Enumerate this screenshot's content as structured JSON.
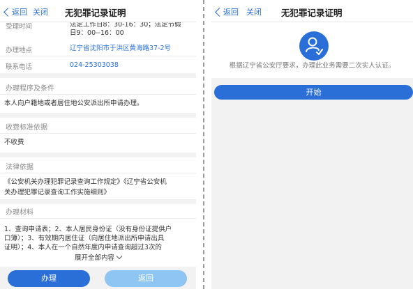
{
  "left": {
    "nav": {
      "back_label": "返回",
      "close_label": "关闭",
      "title": "无犯罪记录证明"
    },
    "info": {
      "hours_label": "受理时间",
      "hours_line1": "法定工作日8：30-16：30；法定节假",
      "hours_line2": "日9：00--16：00",
      "address_label": "办理地点",
      "address_value": "辽宁省沈阳市于洪区黄海路37-2号",
      "phone_label": "联系电话",
      "phone_value": "024-25303038"
    },
    "procedure": {
      "heading": "办理程序及条件",
      "text": "本人向户籍地或者居住地公安派出所申请办理。"
    },
    "fee": {
      "heading": "收费标准依据",
      "text": "不收费"
    },
    "law": {
      "heading": "法律依据",
      "line1": "《公安机关办理犯罪记录查询工作规定》《辽宁省公安机",
      "line2": "关办理犯罪记录查询工作实施细则》"
    },
    "materials": {
      "heading": "办理材料",
      "line1": "1、查询申请表；2、本人居民身份证（没有身份证提供户",
      "line2": "口簿）；3、有效期内居住证（向居住地派出所申请出具",
      "line3": "证明）；4、本人在一个自然年度内申请查询超过3次的",
      "expand_label": "展开全部内容"
    },
    "buttons": {
      "apply_label": "办理",
      "return_label": "返回"
    }
  },
  "right": {
    "nav": {
      "back_label": "返回",
      "close_label": "关闭",
      "title": "无犯罪记录证明"
    },
    "icon": "user-verify-icon",
    "notice": "根据辽宁省公安厅要求，办理此业务需要二次实人认证。",
    "start_label": "开始"
  },
  "colors": {
    "accent": "#2a6fd8",
    "accent_light": "#8fc5f2",
    "background": "#f2f2f2"
  }
}
